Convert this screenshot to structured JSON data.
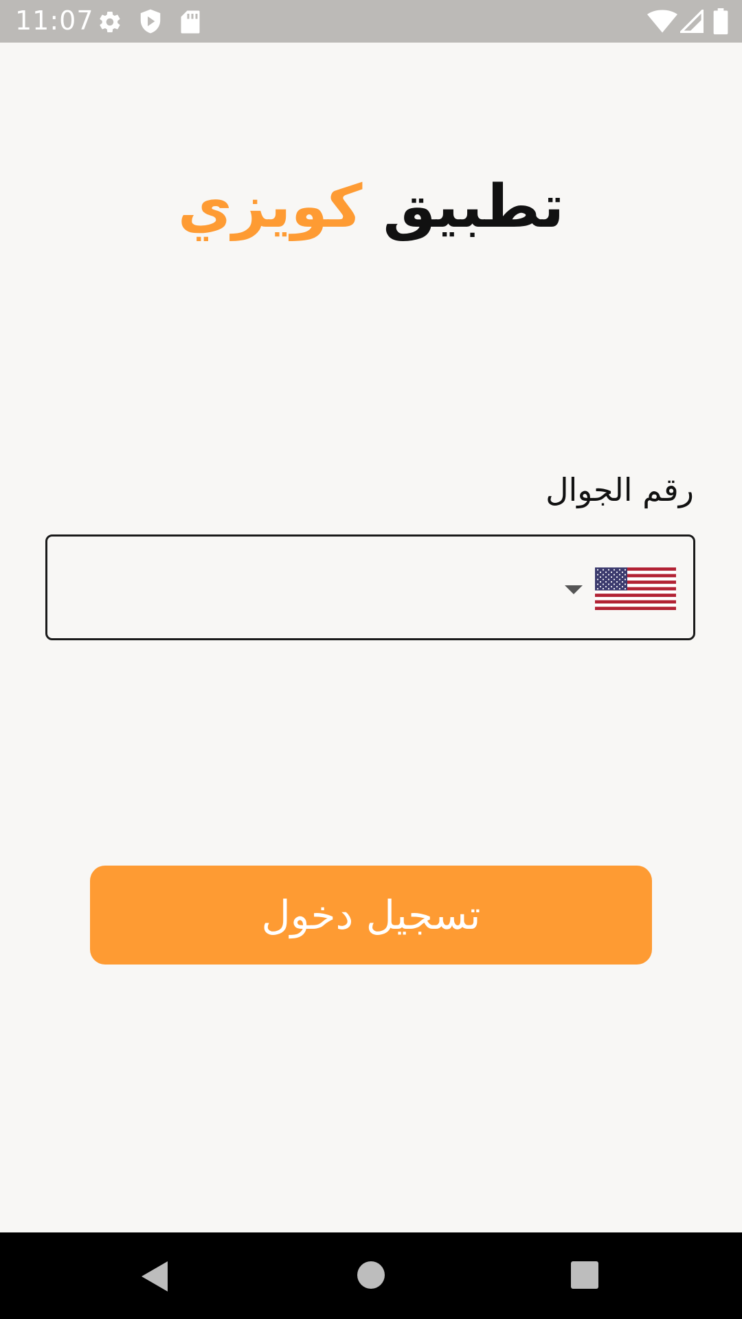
{
  "status_bar": {
    "time": "11:07",
    "icons_left": [
      "gear-icon",
      "shield-play-icon",
      "sd-card-icon"
    ],
    "icons_right": [
      "wifi-icon",
      "cell-signal-icon",
      "battery-icon"
    ],
    "background_color": "#bcbab7"
  },
  "header": {
    "title_word_1": "تطبيق",
    "title_word_2": "كويزي",
    "accent_color": "#fe9b33"
  },
  "form": {
    "phone_label": "رقم الجوال",
    "phone_value": "",
    "country_flag": "us-flag-icon"
  },
  "actions": {
    "login_label": "تسجيل دخول",
    "button_color": "#fe9b33"
  },
  "nav_bar": {
    "buttons": [
      "back-icon",
      "home-icon",
      "recents-icon"
    ]
  }
}
